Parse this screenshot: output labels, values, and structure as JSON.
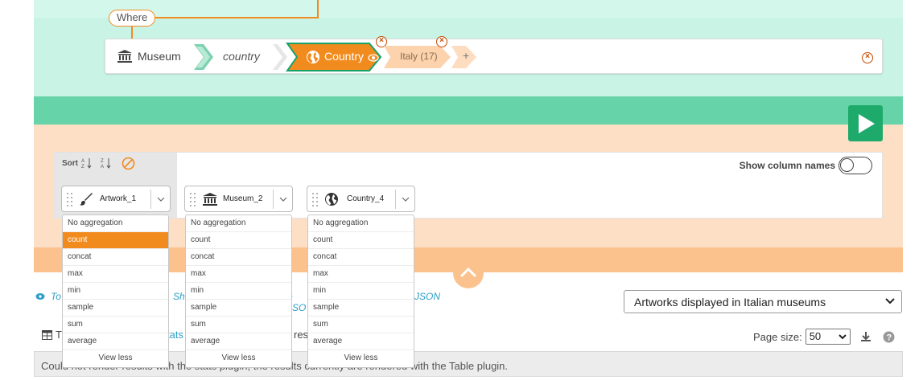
{
  "query": {
    "where_label": "Where",
    "museum_label": "Museum",
    "property_label": "country",
    "country_label": "Country",
    "value_label": "Italy (17)",
    "add_label": "+"
  },
  "sort": {
    "label": "Sort"
  },
  "show_columns": {
    "label": "Show column names"
  },
  "columns": [
    {
      "label": "Artwork_1",
      "icon": "brush-icon"
    },
    {
      "label": "Museum_2",
      "icon": "museum-icon"
    },
    {
      "label": "Country_4",
      "icon": "globe-icon"
    }
  ],
  "aggregations": [
    "No aggregation",
    "count",
    "concat",
    "max",
    "min",
    "sample",
    "sum",
    "average"
  ],
  "view_less": "View less",
  "bottom": {
    "links_visible": [
      "To",
      "Sho",
      "o JSO",
      "JSON"
    ],
    "viz_select": "Artworks displayed in Italian museums",
    "plugin_fragment_left": "T",
    "plugin_fragment_mid": "tats",
    "plugin_fragment_right": "res",
    "page_size_label": "Page size:",
    "page_size_value": "50",
    "message": "Could not render results with the stats plugin, the results currently are rendered with the Table plugin."
  },
  "colors": {
    "accent": "#f28b1e",
    "green": "#1daa6a",
    "link": "#2d9fc8"
  }
}
